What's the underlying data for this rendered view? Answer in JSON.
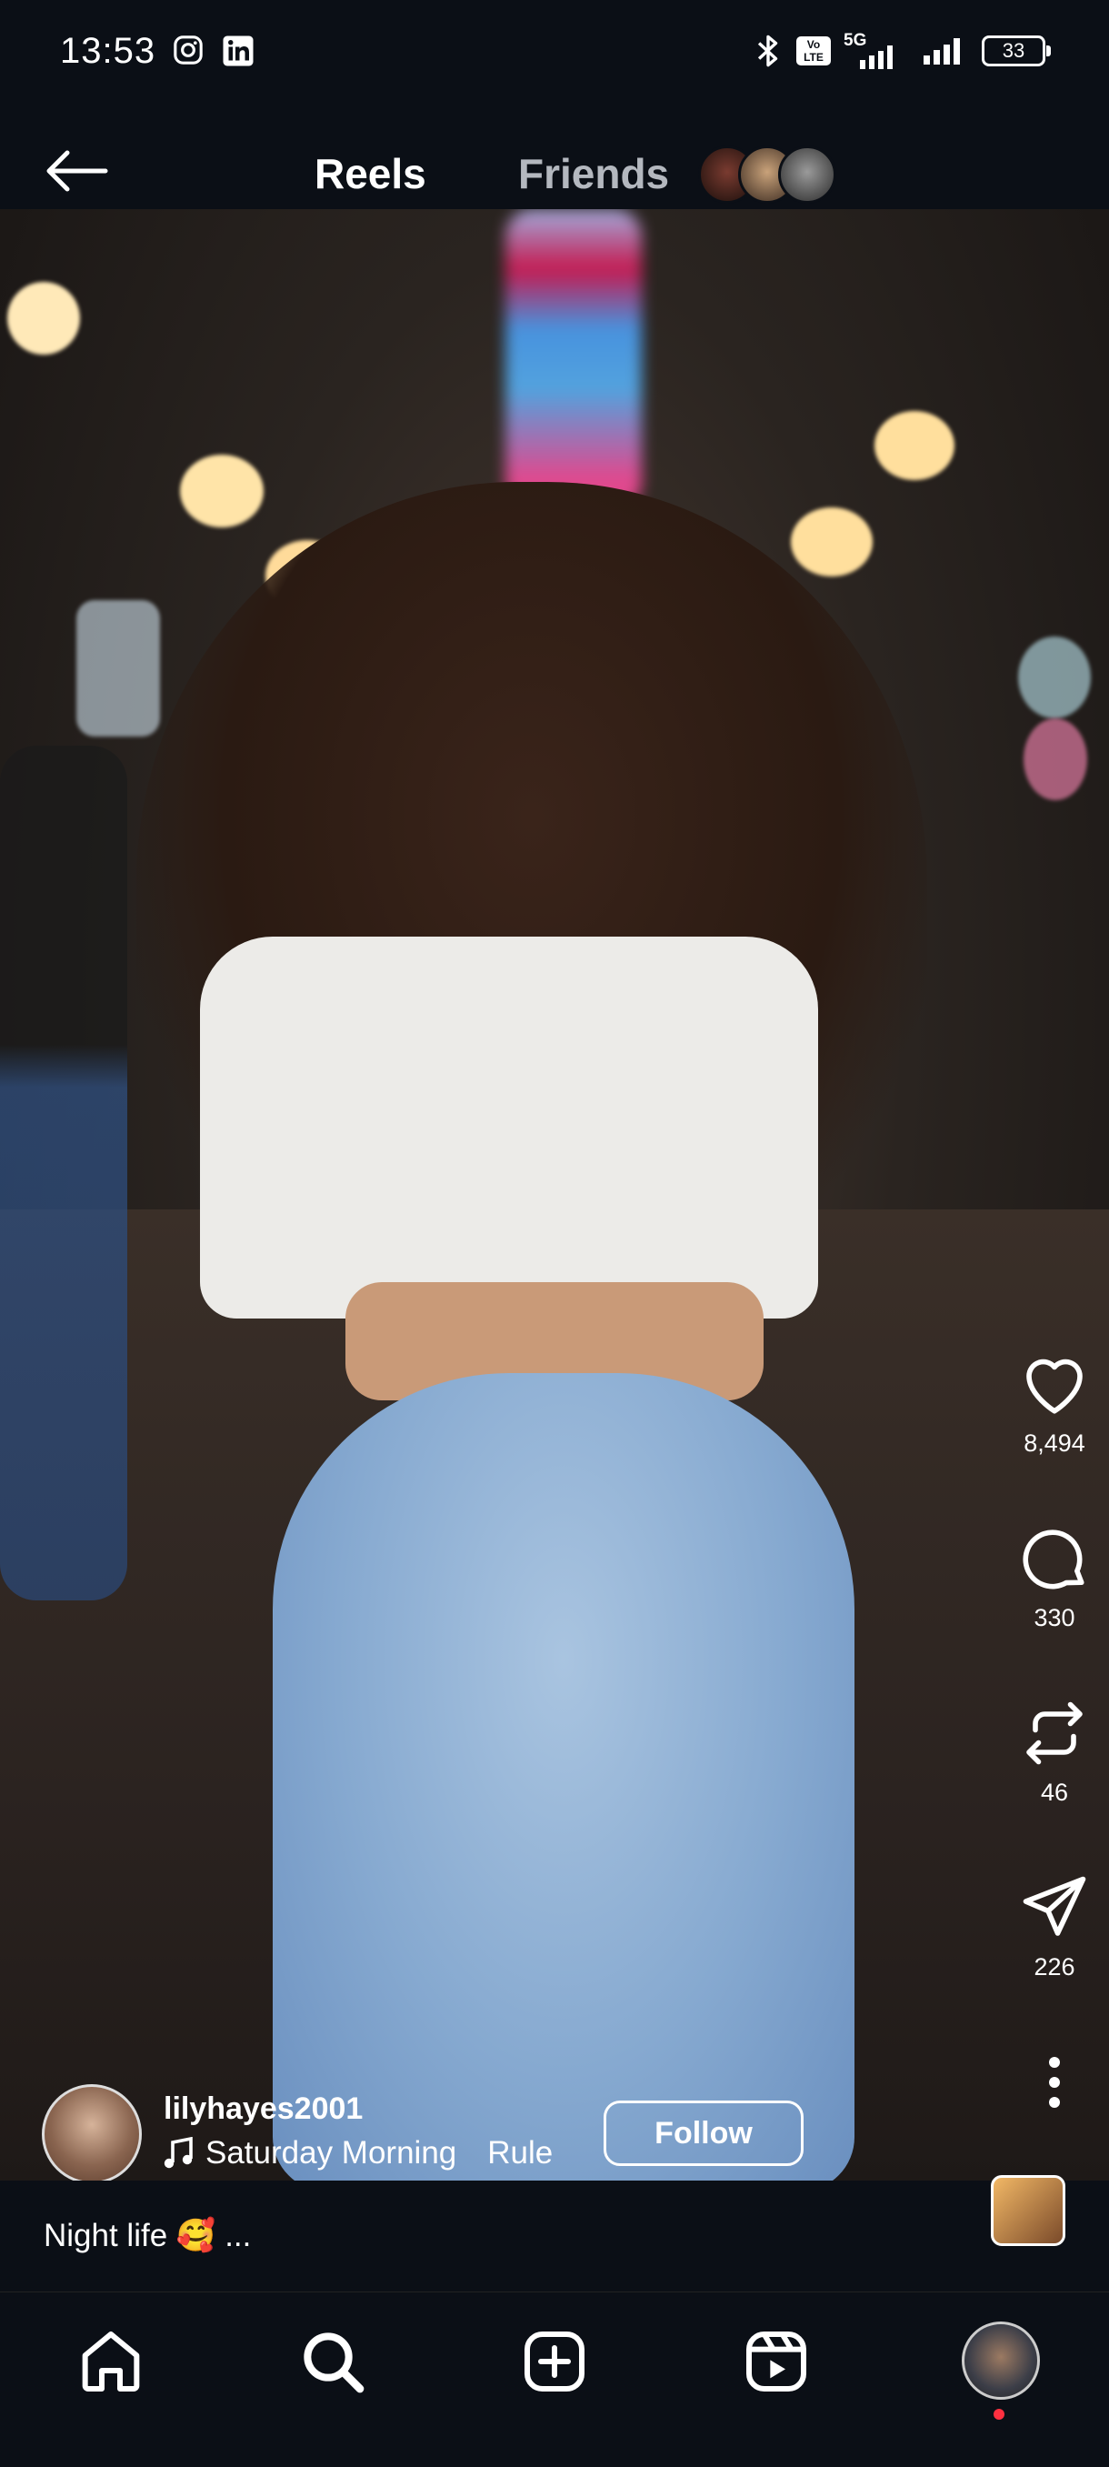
{
  "status_bar": {
    "time": "13:53",
    "battery": "33",
    "network": "5G",
    "volte": "Vo LTE",
    "icons": [
      "instagram-icon",
      "linkedin-icon",
      "bluetooth-icon",
      "volte-icon",
      "signal-5g-icon",
      "signal-icon",
      "battery-icon"
    ]
  },
  "header": {
    "tabs": [
      {
        "label": "Reels",
        "active": true
      },
      {
        "label": "Friends",
        "active": false
      }
    ],
    "friend_avatar_count": 3
  },
  "actions": {
    "likes": "8,494",
    "comments": "330",
    "reposts": "46",
    "shares": "226"
  },
  "author": {
    "username": "lilyhayes2001",
    "audio": "Saturday Morning",
    "audio_more": "Rule",
    "follow_label": "Follow"
  },
  "caption": {
    "text": "Night life 🥰 ..."
  },
  "nav": {
    "items": [
      "home-icon",
      "search-icon",
      "create-icon",
      "reels-icon",
      "profile-avatar"
    ]
  },
  "colors": {
    "background": "#0b0f16",
    "inactive_tab": "#b4b8bf",
    "notification_dot": "#ff3040"
  }
}
